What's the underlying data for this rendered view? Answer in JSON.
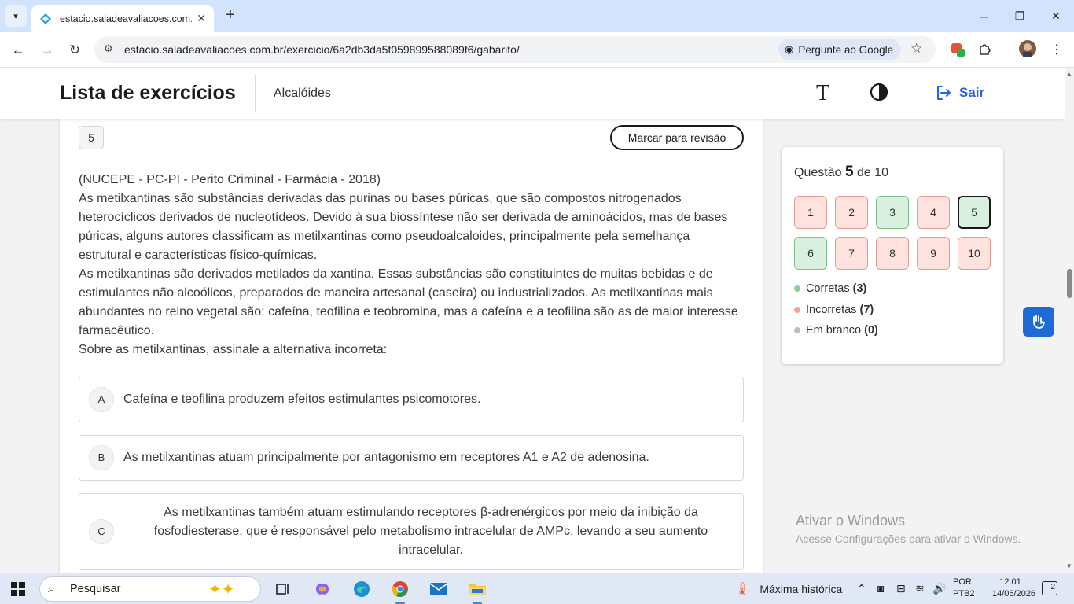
{
  "browser": {
    "tab_title": "estacio.saladeavaliacoes.com.br",
    "url": "estacio.saladeavaliacoes.com.br/exercicio/6a2db3da5f059899588089f6/gabarito/",
    "google_chip": "Pergunte ao Google",
    "icons": [
      "tab-search-icon",
      "close-icon",
      "plus-icon",
      "minimize-icon",
      "restore-icon",
      "back-icon",
      "forward-icon",
      "reload-icon",
      "site-settings-icon",
      "lens-icon",
      "star-icon",
      "extension-icon",
      "puzzle-icon",
      "avatar",
      "kebab-menu-icon"
    ]
  },
  "header": {
    "title": "Lista de exercícios",
    "subject": "Alcalóides",
    "font_icon_glyph": "T",
    "logout_label": "Sair",
    "accent_color": "#2563eb"
  },
  "question": {
    "number": "5",
    "review_label": "Marcar para revisão",
    "source": "(NUCEPE - PC-PI - Perito Criminal - Farmácia - 2018)",
    "paragraph1": "As metilxantinas são substâncias derivadas das purinas ou bases púricas, que são compostos nitrogenados heterocíclicos derivados de nucleotídeos. Devido à sua biossíntese não ser derivada de aminoácidos, mas de bases púricas, alguns autores classificam as metilxantinas como pseudoalcaloides, principalmente pela semelhança estrutural e características físico-químicas.",
    "paragraph2": "As metilxantinas são derivados metilados da xantina. Essas substâncias são constituintes de muitas bebidas e de estimulantes não alcoólicos, preparados de maneira artesanal (caseira) ou industrializados. As metilxantinas mais abundantes no reino vegetal são: cafeína, teofilina e teobromina, mas a cafeína e a teofilina são as de maior interesse farmacêutico.",
    "prompt": "Sobre as metilxantinas, assinale a alternativa incorreta:",
    "alternatives": [
      {
        "letter": "A",
        "text": "Cafeína e teofilina produzem efeitos estimulantes psicomotores."
      },
      {
        "letter": "B",
        "text": "As metilxantinas atuam principalmente por antagonismo em receptores A1 e A2 de adenosina."
      },
      {
        "letter": "C",
        "text": "As metilxantinas também atuam estimulando receptores β-adrenérgicos por meio da inibição da fosfodiesterase, que é responsável pelo metabolismo intracelular de AMPc, levando a seu aumento intracelular."
      }
    ]
  },
  "panel": {
    "label_prefix": "Questão",
    "current": "5",
    "label_suffix": "de 10",
    "questions": [
      {
        "n": "1",
        "status": "wrong"
      },
      {
        "n": "2",
        "status": "wrong"
      },
      {
        "n": "3",
        "status": "right"
      },
      {
        "n": "4",
        "status": "wrong"
      },
      {
        "n": "5",
        "status": "right"
      },
      {
        "n": "6",
        "status": "right"
      },
      {
        "n": "7",
        "status": "wrong"
      },
      {
        "n": "8",
        "status": "wrong"
      },
      {
        "n": "9",
        "status": "wrong"
      },
      {
        "n": "10",
        "status": "wrong"
      }
    ],
    "legend": [
      {
        "label": "Corretas",
        "count": "(3)",
        "color": "#8bd09a"
      },
      {
        "label": "Incorretas",
        "count": "(7)",
        "color": "#f0a399"
      },
      {
        "label": "Em branco",
        "count": "(0)",
        "color": "#bdbdbd"
      }
    ]
  },
  "watermark": {
    "line1": "Ativar o Windows",
    "line2": "Acesse Configurações para ativar o Windows."
  },
  "taskbar": {
    "search_label": "Pesquisar",
    "weather_label": "Máxima histórica",
    "lang_line1": "POR",
    "lang_line2": "PTB2",
    "time": "12:01",
    "date": "14/06/2026",
    "notifications": "2"
  }
}
